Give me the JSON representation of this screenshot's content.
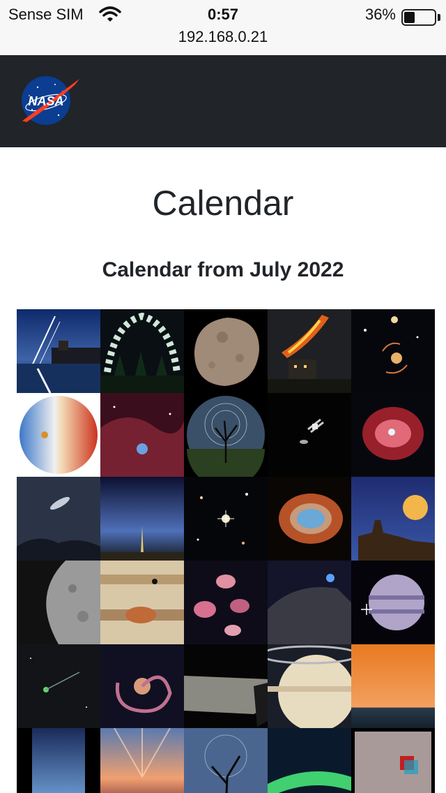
{
  "status_bar": {
    "carrier": "Sense SIM",
    "time": "0:57",
    "battery_percent": "36%",
    "battery_level": 0.36,
    "url": "192.168.0.21"
  },
  "navbar": {
    "logo_text": "NASA",
    "background": "#212429"
  },
  "page": {
    "title": "Calendar",
    "subtitle_prefix": "Calendar from ",
    "subtitle_month": "July 2022"
  },
  "tiles": [
    {
      "name": "tile-river-star-trails"
    },
    {
      "name": "tile-aurora-forest-fisheye"
    },
    {
      "name": "tile-phobos-moon"
    },
    {
      "name": "tile-fireball-over-town"
    },
    {
      "name": "tile-gravitational-lens"
    },
    {
      "name": "tile-earth-wind-map"
    },
    {
      "name": "tile-red-nebula"
    },
    {
      "name": "tile-tree-star-trails"
    },
    {
      "name": "tile-space-station"
    },
    {
      "name": "tile-cats-eye-nebula"
    },
    {
      "name": "tile-andromeda-over-dunes"
    },
    {
      "name": "tile-noctilucent-clouds-city"
    },
    {
      "name": "tile-deep-field"
    },
    {
      "name": "tile-southern-ring-nebula"
    },
    {
      "name": "tile-moon-over-castle"
    },
    {
      "name": "tile-moon-craters"
    },
    {
      "name": "tile-jupiter-red-spot"
    },
    {
      "name": "tile-stephans-quintet"
    },
    {
      "name": "tile-half-dome-night"
    },
    {
      "name": "tile-jupiter-infrared"
    },
    {
      "name": "tile-comet-star-field"
    },
    {
      "name": "tile-spiral-galaxy"
    },
    {
      "name": "tile-lunar-surface"
    },
    {
      "name": "tile-saturn-rings"
    },
    {
      "name": "tile-orange-sunset-sea"
    },
    {
      "name": "tile-noctilucent-blue-band"
    },
    {
      "name": "tile-sunset-rays-lake"
    },
    {
      "name": "tile-star-trails-branch"
    },
    {
      "name": "tile-aurora-green"
    },
    {
      "name": "tile-mars-rover-3d"
    }
  ]
}
